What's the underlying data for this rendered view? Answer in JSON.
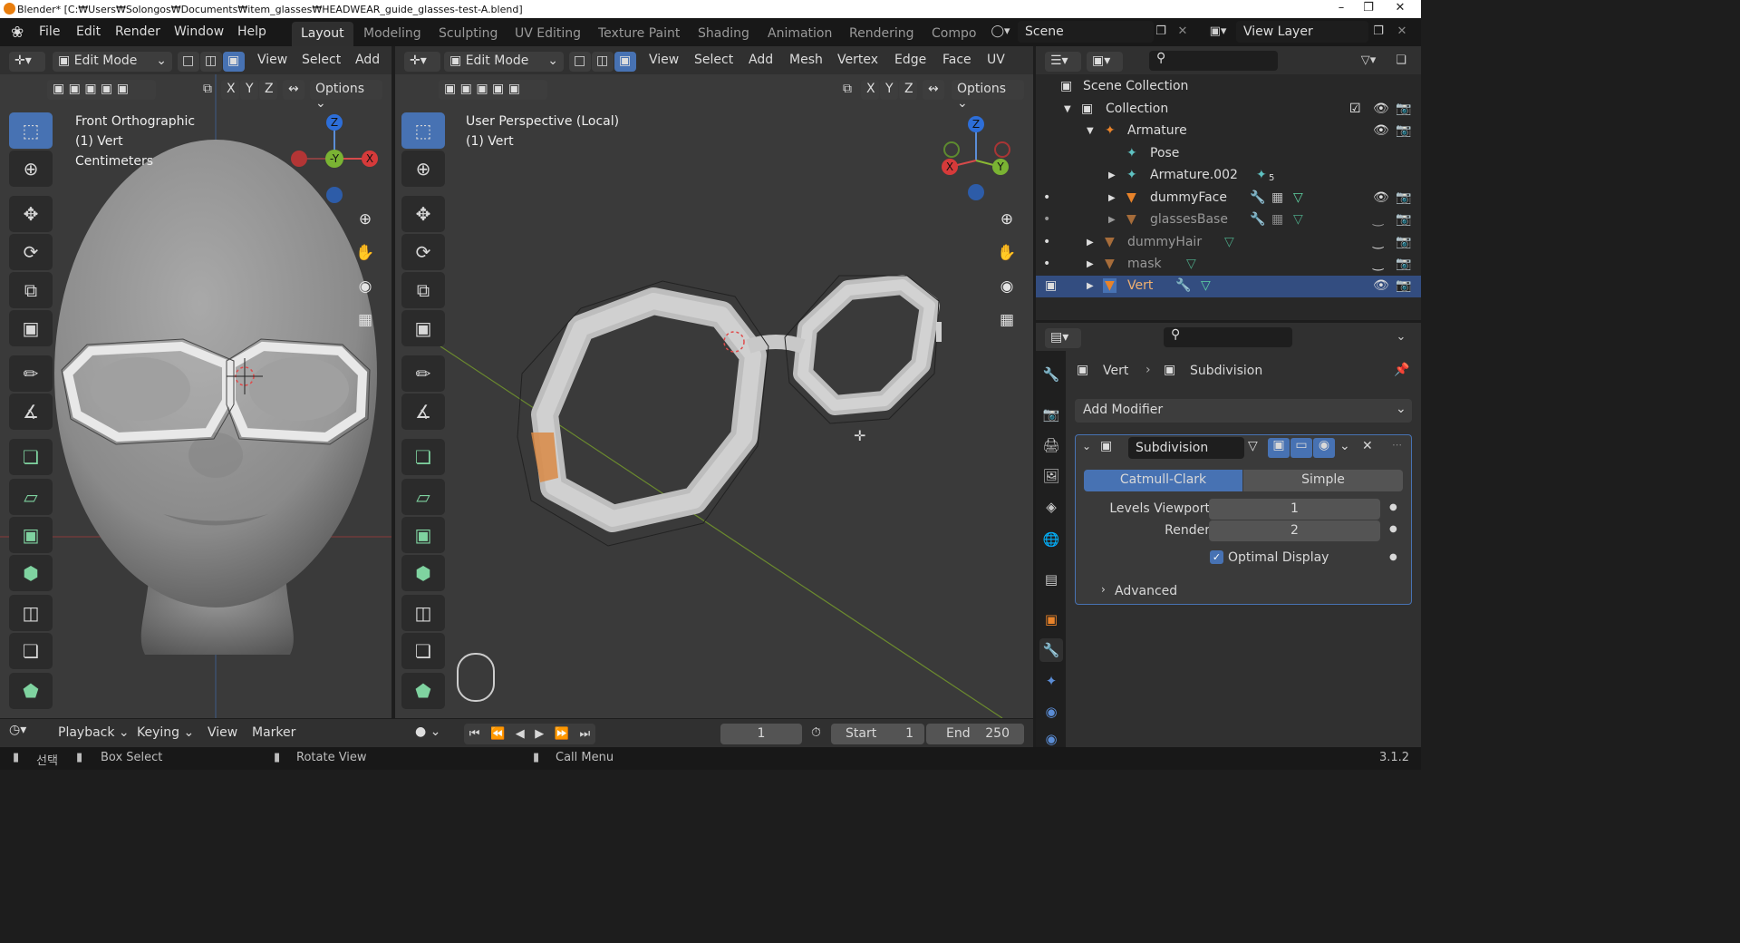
{
  "window": {
    "title": "Blender* [C:₩Users₩Solongos₩Documents₩item_glasses₩HEADWEAR_guide_glasses-test-A.blend]",
    "controls": [
      "minimize-icon",
      "maximize-icon",
      "close-icon"
    ]
  },
  "menubar": {
    "items": [
      "File",
      "Edit",
      "Render",
      "Window",
      "Help"
    ],
    "workspaces": [
      "Layout",
      "Modeling",
      "Sculpting",
      "UV Editing",
      "Texture Paint",
      "Shading",
      "Animation",
      "Rendering",
      "Compo"
    ],
    "active_workspace": "Layout",
    "scene": "Scene",
    "view_layer": "View Layer"
  },
  "left_viewport": {
    "mode": "Edit Mode",
    "menus": [
      "View",
      "Select",
      "Add"
    ],
    "axes": [
      "X",
      "Y",
      "Z"
    ],
    "options_label": "Options",
    "overlay_lines": [
      "Front Orthographic",
      "(1) Vert",
      "Centimeters"
    ],
    "gizmo": {
      "z": "Z",
      "y": "-Y",
      "x": "X"
    }
  },
  "right_viewport": {
    "mode": "Edit Mode",
    "menus": [
      "View",
      "Select",
      "Add",
      "Mesh",
      "Vertex",
      "Edge",
      "Face",
      "UV"
    ],
    "axes": [
      "X",
      "Y",
      "Z"
    ],
    "options_label": "Options",
    "overlay_lines": [
      "User Perspective (Local)",
      "(1) Vert"
    ],
    "gizmo": {
      "z": "Z",
      "y": "Y",
      "x": "X"
    }
  },
  "outliner": {
    "search_placeholder": "",
    "rows": [
      {
        "label": "Scene Collection",
        "icon": "collection-icon"
      },
      {
        "label": "Collection",
        "icon": "collection-icon"
      },
      {
        "label": "Armature",
        "icon": "armature-icon"
      },
      {
        "label": "Pose",
        "icon": "pose-icon"
      },
      {
        "label": "Armature.002",
        "icon": "armature-icon",
        "badge": "5"
      },
      {
        "label": "dummyFace",
        "icon": "mesh-icon"
      },
      {
        "label": "glassesBase",
        "icon": "mesh-icon"
      },
      {
        "label": "dummyHair",
        "icon": "mesh-icon"
      },
      {
        "label": "mask",
        "icon": "mesh-icon"
      },
      {
        "label": "Vert",
        "icon": "mesh-icon",
        "selected": true
      }
    ]
  },
  "properties": {
    "breadcrumb_object": "Vert",
    "breadcrumb_modifier": "Subdivision",
    "add_modifier": "Add Modifier",
    "modifier": {
      "name": "Subdivision",
      "algo_options": [
        "Catmull-Clark",
        "Simple"
      ],
      "active_algo": "Catmull-Clark",
      "levels_viewport_label": "Levels Viewport",
      "levels_viewport": "1",
      "render_label": "Render",
      "render": "2",
      "optimal_display_label": "Optimal Display",
      "optimal_display": true,
      "advanced_label": "Advanced"
    }
  },
  "timeline": {
    "menus": [
      "Playback",
      "Keying",
      "View",
      "Marker"
    ],
    "current_frame": "1",
    "start_label": "Start",
    "start": "1",
    "end_label": "End",
    "end": "250"
  },
  "statusbar": {
    "select": "선택",
    "box_select": "Box Select",
    "rotate_view": "Rotate View",
    "call_menu": "Call Menu",
    "version": "3.1.2"
  },
  "colors": {
    "accent": "#4772b3",
    "selected_row": "#334d80",
    "viewport_bg": "#3a3a3a",
    "mesh_orange": "#e8832a"
  }
}
